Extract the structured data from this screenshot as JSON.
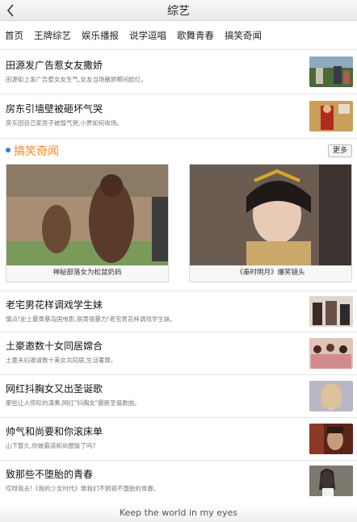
{
  "header": {
    "title": "综艺"
  },
  "nav": {
    "tabs": [
      "首页",
      "王牌综艺",
      "娱乐播报",
      "说学逗唱",
      "歌舞青春",
      "搞笑奇闻"
    ]
  },
  "top_news": [
    {
      "title": "田源发广告惹女友撒娇",
      "summary": "田源街上发广告惹女友生气,女友当场撒娇瞬间脸红。"
    },
    {
      "title": "房东引墙壁被砸坏气哭",
      "summary": "房东因自己家房子被毁气哭,小贾如何收场。"
    }
  ],
  "section": {
    "title": "搞笑奇闻",
    "more_label": "更多"
  },
  "featured": [
    {
      "caption": "神秘部落女为松鼠奶妈"
    },
    {
      "caption": "《秦时明月》爆笑镜头"
    }
  ],
  "list": [
    {
      "title": "老宅男花样调戏学生妹",
      "summary": "慎点!史上最黄暴岛国电影,很黄很暴力!老宅男花样调戏学生妹。"
    },
    {
      "title": "土豪邀数十女同居嫦合",
      "summary": "土豪夫妇邀请数十美女共同居,生活奢靡。"
    },
    {
      "title": "网红抖胸女又出圣诞歌",
      "summary": "那些让人惊叹的演奏,网红\"抖胸女\"最新圣诞歌曲。"
    },
    {
      "title": "帅气和尚要和你滚床单",
      "summary": "山下暂久,你被霸道和尚圈饭了吗?"
    },
    {
      "title": "致那些不堕胎的青春",
      "summary": "哎呀我去!《我的少女时代》致我们不鸦锁不堕胎的青春。"
    }
  ],
  "footer": {
    "text": "Keep the world in my eyes"
  },
  "colors": {
    "section_accent": "#f08a1e",
    "dot": "#2a82da"
  }
}
